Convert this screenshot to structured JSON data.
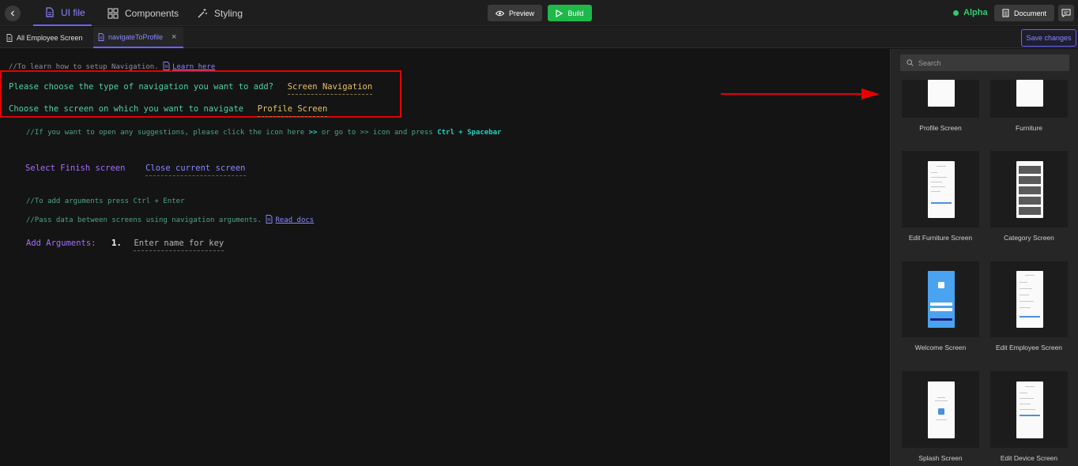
{
  "topbar": {
    "tabs": [
      {
        "label": "UI file",
        "active": true
      },
      {
        "label": "Components",
        "active": false
      },
      {
        "label": "Styling",
        "active": false
      }
    ],
    "preview_label": "Preview",
    "build_label": "Build",
    "status_label": "Alpha",
    "document_label": "Document"
  },
  "file_tabs": [
    {
      "label": "All Employee Screen"
    },
    {
      "label": "navigateToProfile"
    }
  ],
  "save_label": "Save changes",
  "editor": {
    "setup_comment": "//To learn how to setup Navigation.",
    "learn_here": "Learn here",
    "q1": "Please choose the type of navigation you want to add?",
    "a1": "Screen Navigation",
    "q2": "Choose the screen on which you want to navigate",
    "a2": "Profile Screen",
    "suggest_a": "//If you want to open any suggestions, please click the icon here",
    "suggest_b": ">>",
    "suggest_c": "or go to >> icon and press",
    "suggest_d": "Ctrl + Spacebar",
    "finish_label": "Select Finish screen",
    "finish_value": "Close current screen",
    "args_comment": "//To add arguments press Ctrl + Enter",
    "pass_comment": "//Pass data between screens using navigation arguments.",
    "read_docs": "Read docs",
    "add_args_label": "Add Arguments:",
    "arg_number": "1.",
    "arg_placeholder": "Enter name for key"
  },
  "panel": {
    "search_placeholder": "Search",
    "screens": [
      {
        "label": "Profile Screen"
      },
      {
        "label": "Furniture"
      },
      {
        "label": "Edit Furniture Screen"
      },
      {
        "label": "Category Screen"
      },
      {
        "label": "Welcome Screen"
      },
      {
        "label": "Edit Employee Screen"
      },
      {
        "label": "Splash Screen"
      },
      {
        "label": "Edit Device Screen"
      }
    ]
  },
  "colors": {
    "accent": "#6c63ff",
    "build": "#1fb84a",
    "alpha": "#2ecc71",
    "highlight": "#e60000"
  }
}
